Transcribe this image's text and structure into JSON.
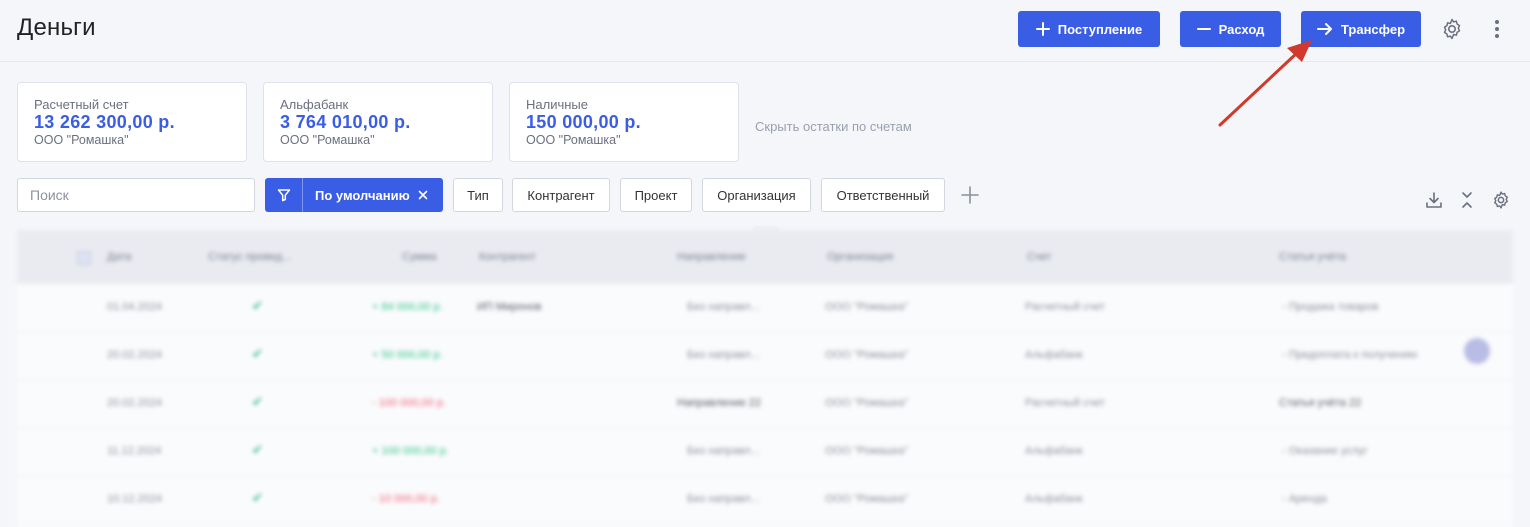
{
  "header": {
    "title": "Деньги",
    "income_label": "Поступление",
    "expense_label": "Расход",
    "transfer_label": "Трансфер",
    "accent": "#3a5de5"
  },
  "accounts": [
    {
      "name": "Расчетный счет",
      "amount": "13 262 300,00 р.",
      "org": "ООО \"Ромашка\""
    },
    {
      "name": "Альфабанк",
      "amount": "3 764 010,00 р.",
      "org": "ООО \"Ромашка\""
    },
    {
      "name": "Наличные",
      "amount": "150 000,00 р.",
      "org": "ООО \"Ромашка\""
    }
  ],
  "hide_balances": "Скрыть остатки по счетам",
  "filters": {
    "search_placeholder": "Поиск",
    "preset_label": "По умолчанию",
    "chips": [
      "Тип",
      "Контрагент",
      "Проект",
      "Организация",
      "Ответственный"
    ]
  },
  "table": {
    "columns": [
      "Дата",
      "Статус провед...",
      "Сумма",
      "Контрагент",
      "Направление",
      "Организация",
      "Счет",
      "Статья учёта"
    ],
    "rows": [
      {
        "date": "01.04.2024",
        "amount": "+ 84 000,00 р.",
        "type": "pos",
        "counterparty": "ИП Миронов",
        "direction": "Без направл...",
        "org": "ООО \"Ромашка\"",
        "account": "Расчетный счет",
        "article": "- Продажа товаров"
      },
      {
        "date": "20.02.2024",
        "amount": "+ 50 000,00 р.",
        "type": "pos",
        "counterparty": "",
        "direction": "Без направл...",
        "org": "ООО \"Ромашка\"",
        "account": "Альфабанк",
        "article": "- Предоплата к получению"
      },
      {
        "date": "20.02.2024",
        "amount": "- 100 000,00 р.",
        "type": "neg",
        "counterparty": "",
        "direction": "Направление 22",
        "org": "ООО \"Ромашка\"",
        "account": "Расчетный счет",
        "article": "Статья учёта 22"
      },
      {
        "date": "11.12.2024",
        "amount": "+ 100 000,00 р.",
        "type": "pos",
        "counterparty": "",
        "direction": "Без направл...",
        "org": "ООО \"Ромашка\"",
        "account": "Альфабанк",
        "article": "- Оказание услуг"
      },
      {
        "date": "10.12.2024",
        "amount": "- 10 000,00 р.",
        "type": "neg",
        "counterparty": "",
        "direction": "Без направл...",
        "org": "ООО \"Ромашка\"",
        "account": "Альфабанк",
        "article": "- Аренда"
      }
    ]
  },
  "annotation": {
    "arrow_color": "#d0392b"
  }
}
